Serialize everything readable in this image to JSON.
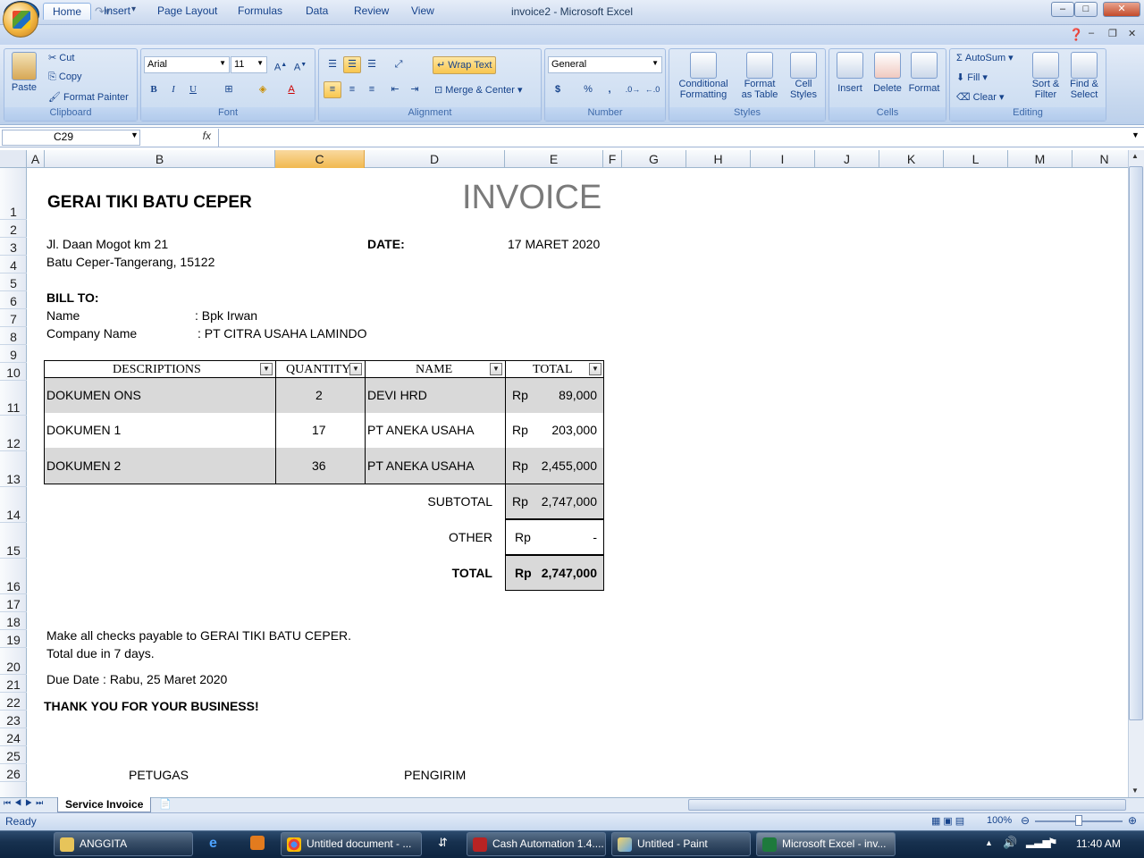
{
  "window": {
    "title": "invoice2 - Microsoft Excel",
    "min": "–",
    "max": "□",
    "close": "✕"
  },
  "tabs": [
    "Home",
    "Insert",
    "Page Layout",
    "Formulas",
    "Data",
    "Review",
    "View"
  ],
  "ribbon": {
    "clipboard": {
      "label": "Clipboard",
      "paste": "Paste",
      "cut": "Cut",
      "copy": "Copy",
      "format_painter": "Format Painter"
    },
    "font": {
      "label": "Font",
      "family": "Arial",
      "size": "11",
      "bold": "B",
      "italic": "I",
      "underline": "U"
    },
    "alignment": {
      "label": "Alignment",
      "wrap_text": "Wrap Text",
      "merge_center": "Merge & Center"
    },
    "number": {
      "label": "Number",
      "format": "General",
      "currency": "$",
      "percent": "%",
      "comma": ","
    },
    "styles": {
      "label": "Styles",
      "conditional_1": "Conditional",
      "conditional_2": "Formatting",
      "format_table_1": "Format",
      "format_table_2": "as Table",
      "cell_styles_1": "Cell",
      "cell_styles_2": "Styles"
    },
    "cells": {
      "label": "Cells",
      "insert": "Insert",
      "delete": "Delete",
      "format": "Format"
    },
    "editing": {
      "label": "Editing",
      "autosum": "AutoSum",
      "fill": "Fill",
      "clear": "Clear",
      "sort_1": "Sort &",
      "sort_2": "Filter",
      "find_1": "Find &",
      "find_2": "Select"
    }
  },
  "formula_bar": {
    "name_box": "C29",
    "fx": "fx",
    "value": ""
  },
  "columns": [
    "A",
    "B",
    "C",
    "D",
    "E",
    "F",
    "G",
    "H",
    "I",
    "J",
    "K",
    "L",
    "M",
    "N"
  ],
  "selected_column": "C",
  "rows": [
    "1",
    "2",
    "3",
    "4",
    "5",
    "6",
    "7",
    "8",
    "9",
    "10",
    "11",
    "12",
    "13",
    "14",
    "15",
    "16",
    "17",
    "18",
    "19",
    "20",
    "21",
    "22",
    "23",
    "24",
    "25",
    "26"
  ],
  "invoice": {
    "company": "GERAI TIKI BATU CEPER",
    "heading": "INVOICE",
    "address_1": "Jl. Daan Mogot km 21",
    "address_2": "Batu Ceper-Tangerang, 15122",
    "date_label": "DATE:",
    "date_value": "17 MARET 2020",
    "bill_to": "BILL TO:",
    "name_label": "Name",
    "name_value": ": Bpk Irwan",
    "company_label": "Company Name",
    "company_value": ": PT CITRA USAHA LAMINDO",
    "headers": {
      "desc": "DESCRIPTIONS",
      "qty": "QUANTITY",
      "name": "NAME",
      "total": "TOTAL"
    },
    "items": [
      {
        "desc": "DOKUMEN ONS",
        "qty": "2",
        "name": "DEVI HRD",
        "cur": "Rp",
        "amount": "89,000"
      },
      {
        "desc": "DOKUMEN 1",
        "qty": "17",
        "name": "PT ANEKA USAHA",
        "cur": "Rp",
        "amount": "203,000"
      },
      {
        "desc": "DOKUMEN 2",
        "qty": "36",
        "name": "PT ANEKA USAHA",
        "cur": "Rp",
        "amount": "2,455,000"
      }
    ],
    "subtotal_label": "SUBTOTAL",
    "subtotal_cur": "Rp",
    "subtotal_value": "2,747,000",
    "other_label": "OTHER",
    "other_cur": "Rp",
    "other_value": "-",
    "total_label": "TOTAL",
    "total_cur": "Rp",
    "total_value": "2,747,000",
    "note_1": "Make all checks payable to GERAI TIKI BATU CEPER.",
    "note_2": "Total due in 7 days.",
    "due_date": "Due Date : Rabu, 25 Maret 2020",
    "thanks": "THANK YOU FOR YOUR BUSINESS!",
    "sign_1": "PETUGAS",
    "sign_2": "PENGIRIM"
  },
  "sheet_tab": "Service Invoice",
  "status": {
    "ready": "Ready",
    "zoom": "100%"
  },
  "taskbar": {
    "items": [
      "ANGGITA",
      "Untitled document - ...",
      "Cash Automation 1.4....",
      "Untitled - Paint",
      "Microsoft Excel - inv..."
    ],
    "clock": "11:40 AM"
  }
}
